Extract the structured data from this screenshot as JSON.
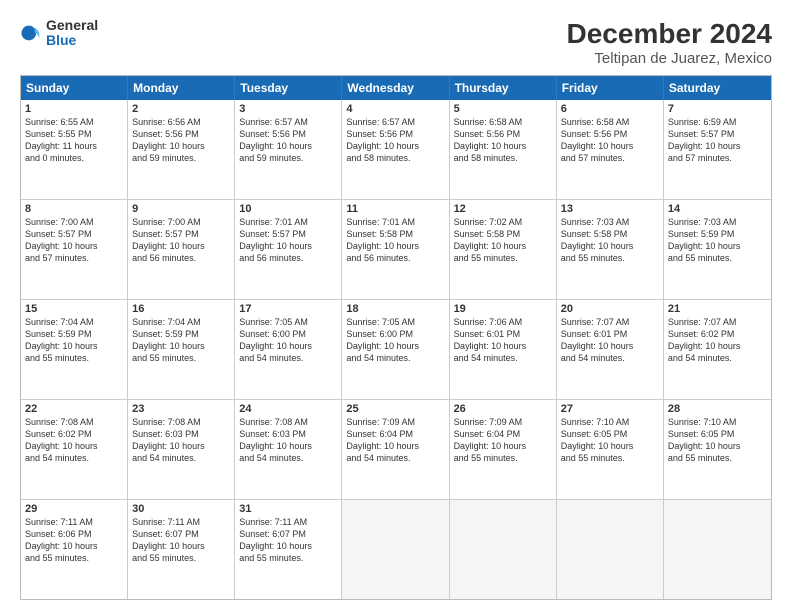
{
  "logo": {
    "general": "General",
    "blue": "Blue"
  },
  "title": "December 2024",
  "subtitle": "Teltipan de Juarez, Mexico",
  "days": [
    "Sunday",
    "Monday",
    "Tuesday",
    "Wednesday",
    "Thursday",
    "Friday",
    "Saturday"
  ],
  "weeks": [
    [
      {
        "day": "1",
        "rise": "6:55 AM",
        "set": "5:55 PM",
        "daylight": "11 hours and 0 minutes."
      },
      {
        "day": "2",
        "rise": "6:56 AM",
        "set": "5:56 PM",
        "daylight": "10 hours and 59 minutes."
      },
      {
        "day": "3",
        "rise": "6:57 AM",
        "set": "5:56 PM",
        "daylight": "10 hours and 59 minutes."
      },
      {
        "day": "4",
        "rise": "6:57 AM",
        "set": "5:56 PM",
        "daylight": "10 hours and 58 minutes."
      },
      {
        "day": "5",
        "rise": "6:58 AM",
        "set": "5:56 PM",
        "daylight": "10 hours and 58 minutes."
      },
      {
        "day": "6",
        "rise": "6:58 AM",
        "set": "5:56 PM",
        "daylight": "10 hours and 57 minutes."
      },
      {
        "day": "7",
        "rise": "6:59 AM",
        "set": "5:57 PM",
        "daylight": "10 hours and 57 minutes."
      }
    ],
    [
      {
        "day": "8",
        "rise": "7:00 AM",
        "set": "5:57 PM",
        "daylight": "10 hours and 57 minutes."
      },
      {
        "day": "9",
        "rise": "7:00 AM",
        "set": "5:57 PM",
        "daylight": "10 hours and 56 minutes."
      },
      {
        "day": "10",
        "rise": "7:01 AM",
        "set": "5:57 PM",
        "daylight": "10 hours and 56 minutes."
      },
      {
        "day": "11",
        "rise": "7:01 AM",
        "set": "5:58 PM",
        "daylight": "10 hours and 56 minutes."
      },
      {
        "day": "12",
        "rise": "7:02 AM",
        "set": "5:58 PM",
        "daylight": "10 hours and 55 minutes."
      },
      {
        "day": "13",
        "rise": "7:03 AM",
        "set": "5:58 PM",
        "daylight": "10 hours and 55 minutes."
      },
      {
        "day": "14",
        "rise": "7:03 AM",
        "set": "5:59 PM",
        "daylight": "10 hours and 55 minutes."
      }
    ],
    [
      {
        "day": "15",
        "rise": "7:04 AM",
        "set": "5:59 PM",
        "daylight": "10 hours and 55 minutes."
      },
      {
        "day": "16",
        "rise": "7:04 AM",
        "set": "5:59 PM",
        "daylight": "10 hours and 55 minutes."
      },
      {
        "day": "17",
        "rise": "7:05 AM",
        "set": "6:00 PM",
        "daylight": "10 hours and 54 minutes."
      },
      {
        "day": "18",
        "rise": "7:05 AM",
        "set": "6:00 PM",
        "daylight": "10 hours and 54 minutes."
      },
      {
        "day": "19",
        "rise": "7:06 AM",
        "set": "6:01 PM",
        "daylight": "10 hours and 54 minutes."
      },
      {
        "day": "20",
        "rise": "7:07 AM",
        "set": "6:01 PM",
        "daylight": "10 hours and 54 minutes."
      },
      {
        "day": "21",
        "rise": "7:07 AM",
        "set": "6:02 PM",
        "daylight": "10 hours and 54 minutes."
      }
    ],
    [
      {
        "day": "22",
        "rise": "7:08 AM",
        "set": "6:02 PM",
        "daylight": "10 hours and 54 minutes."
      },
      {
        "day": "23",
        "rise": "7:08 AM",
        "set": "6:03 PM",
        "daylight": "10 hours and 54 minutes."
      },
      {
        "day": "24",
        "rise": "7:08 AM",
        "set": "6:03 PM",
        "daylight": "10 hours and 54 minutes."
      },
      {
        "day": "25",
        "rise": "7:09 AM",
        "set": "6:04 PM",
        "daylight": "10 hours and 54 minutes."
      },
      {
        "day": "26",
        "rise": "7:09 AM",
        "set": "6:04 PM",
        "daylight": "10 hours and 55 minutes."
      },
      {
        "day": "27",
        "rise": "7:10 AM",
        "set": "6:05 PM",
        "daylight": "10 hours and 55 minutes."
      },
      {
        "day": "28",
        "rise": "7:10 AM",
        "set": "6:05 PM",
        "daylight": "10 hours and 55 minutes."
      }
    ],
    [
      {
        "day": "29",
        "rise": "7:11 AM",
        "set": "6:06 PM",
        "daylight": "10 hours and 55 minutes."
      },
      {
        "day": "30",
        "rise": "7:11 AM",
        "set": "6:07 PM",
        "daylight": "10 hours and 55 minutes."
      },
      {
        "day": "31",
        "rise": "7:11 AM",
        "set": "6:07 PM",
        "daylight": "10 hours and 55 minutes."
      },
      null,
      null,
      null,
      null
    ]
  ]
}
